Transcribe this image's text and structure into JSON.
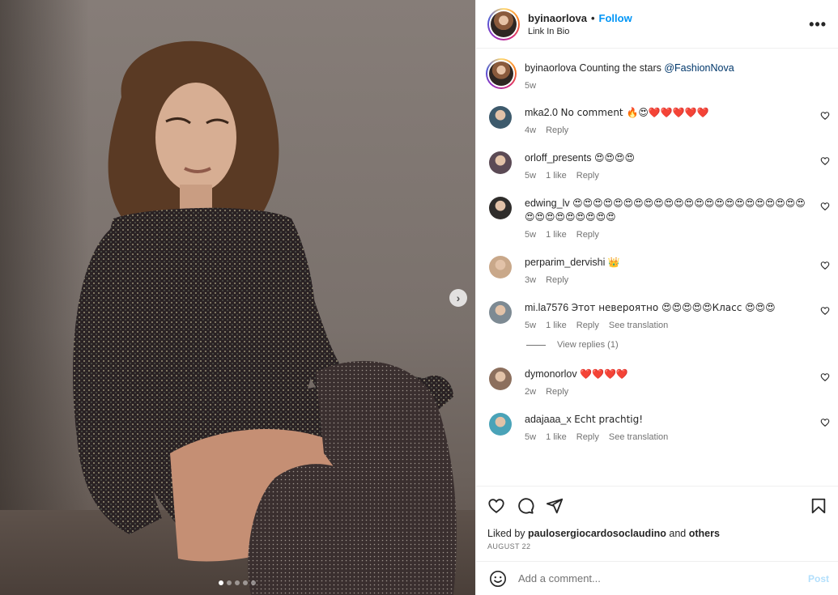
{
  "post": {
    "author": "byinaorlova",
    "separator": "•",
    "follow_label": "Follow",
    "subtitle": "Link In Bio",
    "more_label": "•••",
    "caption_text": "Counting the stars ",
    "caption_mention": "@FashionNova",
    "caption_age": "5w"
  },
  "media": {
    "slide_count": 5,
    "active_slide": 1,
    "next_glyph": "›"
  },
  "comments": [
    {
      "user": "mka2.0",
      "text": "No comment 🔥😍❤️❤️❤️❤️❤️",
      "age": "4w",
      "likes": "",
      "reply": "Reply",
      "translate": "",
      "avatar_color": "#3d5a6c"
    },
    {
      "user": "orloff_presents",
      "text": "😍😍😍😍",
      "age": "5w",
      "likes": "1 like",
      "reply": "Reply",
      "translate": "",
      "avatar_color": "#5b4a55"
    },
    {
      "user": "edwing_lv",
      "text": "😍😍😍😍😍😍😍😍😍😍😍😍😍😍😍😍😍😍😍😍😍😍😍😍😍😍😍😍😍😍😍😍",
      "age": "5w",
      "likes": "1 like",
      "reply": "Reply",
      "translate": "",
      "avatar_color": "#2f2d2b"
    },
    {
      "user": "perparim_dervishi",
      "text": "👑",
      "age": "3w",
      "likes": "",
      "reply": "Reply",
      "translate": "",
      "avatar_color": "#c9a88a"
    },
    {
      "user": "mi.la7576",
      "text": "Этот невероятно 😍😍😍😍😍Класс 😍😍😍",
      "age": "5w",
      "likes": "1 like",
      "reply": "Reply",
      "translate": "See translation",
      "avatar_color": "#7d8a93"
    },
    {
      "user": "dymonorlov",
      "text": "❤️❤️❤️❤️",
      "age": "2w",
      "likes": "",
      "reply": "Reply",
      "translate": "",
      "avatar_color": "#8c6f5d"
    },
    {
      "user": "adajaaa_x",
      "text": "Echt prachtig!",
      "age": "5w",
      "likes": "1 like",
      "reply": "Reply",
      "translate": "See translation",
      "avatar_color": "#4aa3b8"
    }
  ],
  "view_replies": "View replies (1)",
  "likes_summary": {
    "prefix": "Liked by ",
    "user": "paulosergiocardosoclaudino",
    "middle": " and ",
    "others": "others"
  },
  "date": "AUGUST 22",
  "add_comment": {
    "placeholder": "Add a comment...",
    "post_label": "Post"
  },
  "colors": {
    "follow": "#0095f6",
    "mention": "#00376b",
    "muted": "#737373",
    "post_disabled": "#b2dffc"
  }
}
